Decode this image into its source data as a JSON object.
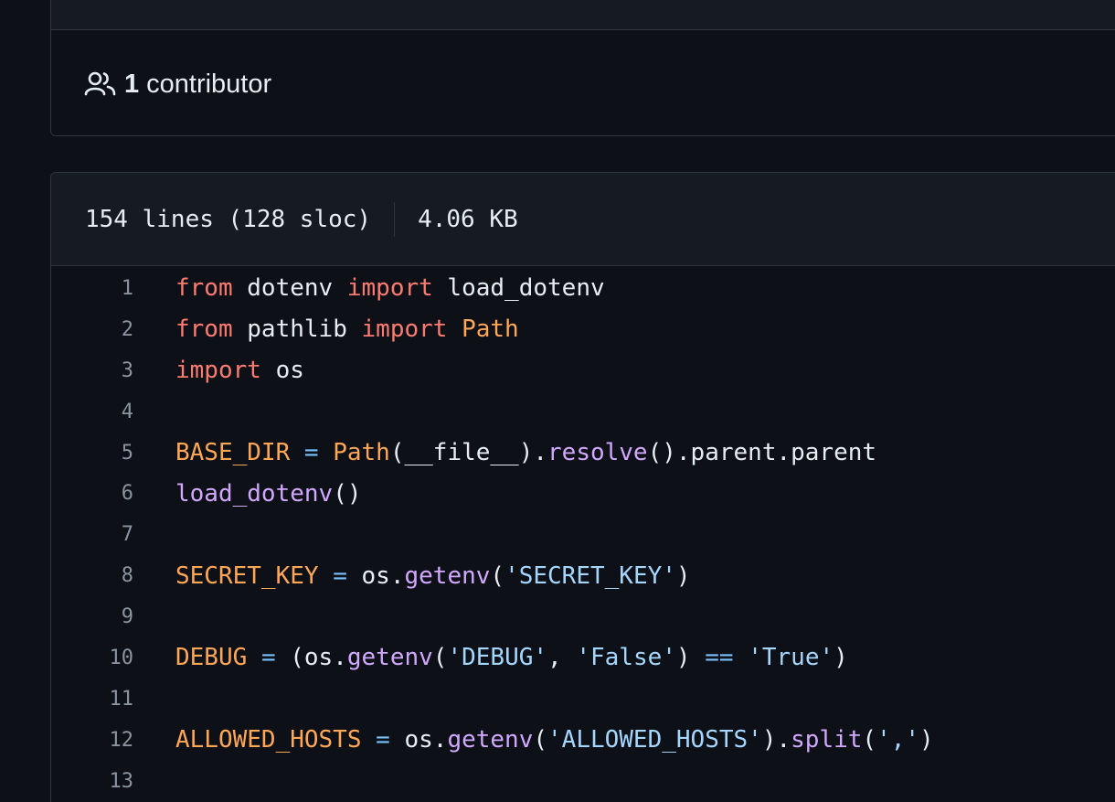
{
  "contributors": {
    "count": "1",
    "label": "contributor",
    "icon": "people-icon"
  },
  "file_info": {
    "lines": "154 lines (128 sloc)",
    "size": "4.06 KB"
  },
  "code": {
    "lines": [
      {
        "n": "1",
        "tokens": [
          {
            "t": "from",
            "c": "kw"
          },
          {
            "t": " dotenv ",
            "c": "src"
          },
          {
            "t": "import",
            "c": "kw"
          },
          {
            "t": " load_dotenv",
            "c": "src"
          }
        ]
      },
      {
        "n": "2",
        "tokens": [
          {
            "t": "from",
            "c": "kw"
          },
          {
            "t": " pathlib ",
            "c": "src"
          },
          {
            "t": "import",
            "c": "kw"
          },
          {
            "t": " ",
            "c": "src"
          },
          {
            "t": "Path",
            "c": "cls"
          }
        ]
      },
      {
        "n": "3",
        "tokens": [
          {
            "t": "import",
            "c": "kw"
          },
          {
            "t": " os",
            "c": "src"
          }
        ]
      },
      {
        "n": "4",
        "tokens": []
      },
      {
        "n": "5",
        "tokens": [
          {
            "t": "BASE_DIR",
            "c": "cls"
          },
          {
            "t": " ",
            "c": "src"
          },
          {
            "t": "=",
            "c": "op"
          },
          {
            "t": " ",
            "c": "src"
          },
          {
            "t": "Path",
            "c": "cls"
          },
          {
            "t": "(__file__).",
            "c": "src"
          },
          {
            "t": "resolve",
            "c": "fn"
          },
          {
            "t": "().parent.parent",
            "c": "src"
          }
        ]
      },
      {
        "n": "6",
        "tokens": [
          {
            "t": "load_dotenv",
            "c": "fn"
          },
          {
            "t": "()",
            "c": "src"
          }
        ]
      },
      {
        "n": "7",
        "tokens": []
      },
      {
        "n": "8",
        "tokens": [
          {
            "t": "SECRET_KEY",
            "c": "cls"
          },
          {
            "t": " ",
            "c": "src"
          },
          {
            "t": "=",
            "c": "op"
          },
          {
            "t": " os.",
            "c": "src"
          },
          {
            "t": "getenv",
            "c": "fn"
          },
          {
            "t": "(",
            "c": "src"
          },
          {
            "t": "'SECRET_KEY'",
            "c": "str"
          },
          {
            "t": ")",
            "c": "src"
          }
        ]
      },
      {
        "n": "9",
        "tokens": []
      },
      {
        "n": "10",
        "tokens": [
          {
            "t": "DEBUG",
            "c": "cls"
          },
          {
            "t": " ",
            "c": "src"
          },
          {
            "t": "=",
            "c": "op"
          },
          {
            "t": " (os.",
            "c": "src"
          },
          {
            "t": "getenv",
            "c": "fn"
          },
          {
            "t": "(",
            "c": "src"
          },
          {
            "t": "'DEBUG'",
            "c": "str"
          },
          {
            "t": ", ",
            "c": "src"
          },
          {
            "t": "'False'",
            "c": "str"
          },
          {
            "t": ") ",
            "c": "src"
          },
          {
            "t": "==",
            "c": "op"
          },
          {
            "t": " ",
            "c": "src"
          },
          {
            "t": "'True'",
            "c": "str"
          },
          {
            "t": ")",
            "c": "src"
          }
        ]
      },
      {
        "n": "11",
        "tokens": []
      },
      {
        "n": "12",
        "tokens": [
          {
            "t": "ALLOWED_HOSTS",
            "c": "cls"
          },
          {
            "t": " ",
            "c": "src"
          },
          {
            "t": "=",
            "c": "op"
          },
          {
            "t": " os.",
            "c": "src"
          },
          {
            "t": "getenv",
            "c": "fn"
          },
          {
            "t": "(",
            "c": "src"
          },
          {
            "t": "'ALLOWED_HOSTS'",
            "c": "str"
          },
          {
            "t": ").",
            "c": "src"
          },
          {
            "t": "split",
            "c": "fn"
          },
          {
            "t": "(",
            "c": "src"
          },
          {
            "t": "','",
            "c": "str"
          },
          {
            "t": ")",
            "c": "src"
          }
        ]
      },
      {
        "n": "13",
        "tokens": []
      }
    ]
  },
  "colors": {
    "background": "#0d1117",
    "header": "#161b22",
    "border": "#30363d",
    "text": "#e6edf3",
    "line_number": "#8b949e",
    "keyword": "#ff7b72",
    "constant": "#ffa657",
    "function": "#d2a8ff",
    "string": "#a5d6ff",
    "operator": "#79c0ff"
  }
}
